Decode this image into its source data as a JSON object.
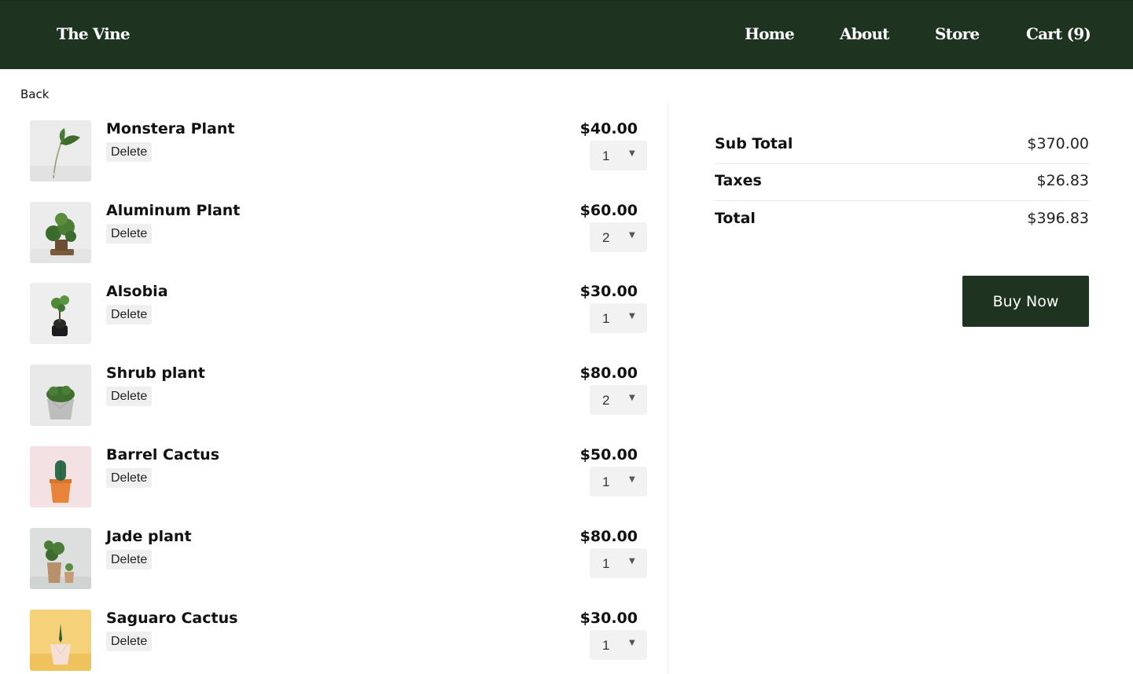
{
  "header": {
    "brand": "The Vine",
    "nav": [
      {
        "label": "Home"
      },
      {
        "label": "About"
      },
      {
        "label": "Store"
      },
      {
        "label": "Cart (9)"
      }
    ]
  },
  "back_label": "Back",
  "cart": {
    "delete_label": "Delete",
    "items": [
      {
        "name": "Monstera Plant",
        "price": "$40.00",
        "qty": "1",
        "image": "monstera-plant-photo"
      },
      {
        "name": "Aluminum Plant",
        "price": "$60.00",
        "qty": "2",
        "image": "aluminum-plant-photo"
      },
      {
        "name": "Alsobia",
        "price": "$30.00",
        "qty": "1",
        "image": "alsobia-plant-photo"
      },
      {
        "name": "Shrub plant",
        "price": "$80.00",
        "qty": "2",
        "image": "shrub-plant-photo"
      },
      {
        "name": "Barrel Cactus",
        "price": "$50.00",
        "qty": "1",
        "image": "barrel-cactus-photo"
      },
      {
        "name": "Jade plant",
        "price": "$80.00",
        "qty": "1",
        "image": "jade-plant-photo"
      },
      {
        "name": "Saguaro Cactus",
        "price": "$30.00",
        "qty": "1",
        "image": "saguaro-cactus-photo"
      }
    ]
  },
  "summary": {
    "subtotal_label": "Sub Total",
    "subtotal_value": "$370.00",
    "taxes_label": "Taxes",
    "taxes_value": "$26.83",
    "total_label": "Total",
    "total_value": "$396.83",
    "buy_label": "Buy Now"
  },
  "colors": {
    "header_bg": "#1e3420",
    "button_bg": "#1e3420"
  }
}
